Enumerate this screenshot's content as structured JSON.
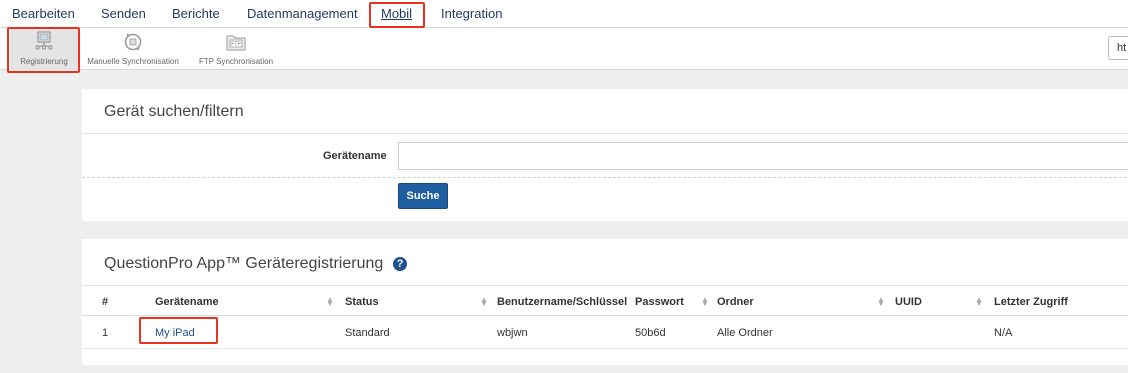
{
  "nav": {
    "items": [
      "Bearbeiten",
      "Senden",
      "Berichte",
      "Datenmanagement",
      "Mobil",
      "Integration"
    ],
    "active": "Mobil"
  },
  "toolbar": {
    "items": [
      {
        "label": "Registrierung",
        "icon": "device-registration-icon",
        "active": true
      },
      {
        "label": "Manuelle Synchronisation",
        "icon": "sync-icon",
        "active": false
      },
      {
        "label": "FTP Synchronisation",
        "icon": "ftp-folder-icon",
        "active": false
      }
    ],
    "url_value": "ht"
  },
  "search": {
    "title": "Gerät suchen/filtern",
    "field_label": "Gerätename",
    "field_value": "",
    "button_label": "Suche"
  },
  "registry": {
    "title": "QuestionPro App™ Geräteregistrierung",
    "help_icon": "?",
    "columns": [
      "#",
      "Gerätename",
      "Status",
      "Benutzername/Schlüssel",
      "Passwort",
      "Ordner",
      "UUID",
      "Letzter Zugriff"
    ],
    "rows": [
      {
        "num": "1",
        "device": "My iPad",
        "status": "Standard",
        "user": "wbjwn",
        "password": "50b6d",
        "folder": "Alle Ordner",
        "uuid": "",
        "last": "N/A"
      }
    ]
  },
  "colors": {
    "highlight": "#e8321f",
    "link": "#1f4f8c",
    "button": "#1f5e9f"
  }
}
